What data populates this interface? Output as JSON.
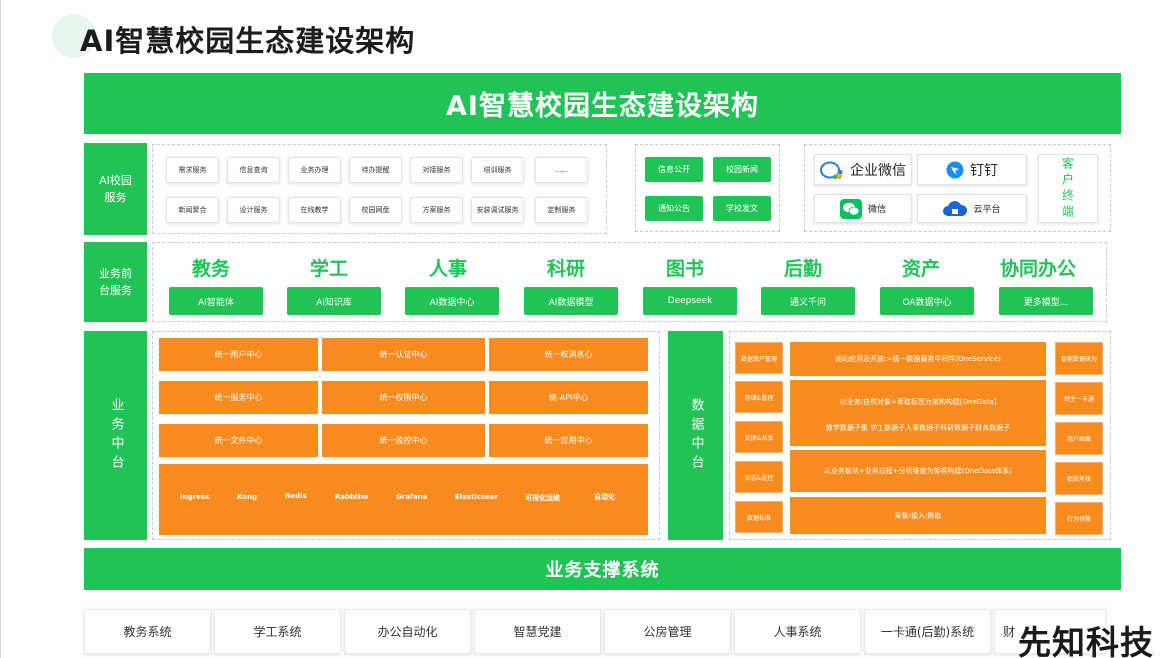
{
  "page_title": "AI智慧校园生态建设架构",
  "banner_title": "AI智慧校园生态建设架构",
  "row_labels": {
    "ai_services": "AI校园服务",
    "frontend": "业务前台服务",
    "business_center": "业务中台",
    "data_center": "数据中台"
  },
  "ai_services": {
    "grid": [
      "需求服务",
      "信息查询",
      "业务办理",
      "待办提醒",
      "对接服务",
      "培训服务",
      "......",
      "新闻聚合",
      "设计服务",
      "在线教学",
      "校园网盘",
      "方案服务",
      "安装调试服务",
      "定制服务"
    ],
    "green": [
      "信息公开",
      "校园新闻",
      "通知公告",
      "学校发文"
    ],
    "apps": [
      {
        "label": "企业微信",
        "icon": "wecom-icon",
        "color": "#2a7fe4"
      },
      {
        "label": "钉钉",
        "icon": "dingtalk-icon",
        "color": "#1a8cff"
      },
      {
        "label": "微信",
        "icon": "wechat-icon",
        "color": "#07c160"
      },
      {
        "label": "云平台",
        "icon": "cloud-icon",
        "color": "#1a66d6"
      }
    ],
    "client": "客户终端"
  },
  "modules": [
    {
      "title": "教务",
      "btn": "AI智能体"
    },
    {
      "title": "学工",
      "btn": "AI知识库"
    },
    {
      "title": "人事",
      "btn": "AI数据中心"
    },
    {
      "title": "科研",
      "btn": "AI数据模型"
    },
    {
      "title": "图书",
      "btn": "Deepseek"
    },
    {
      "title": "后勤",
      "btn": "通义千问"
    },
    {
      "title": "资产",
      "btn": "OA数据中心"
    },
    {
      "title": "协同办公",
      "btn": "更多模型..."
    }
  ],
  "business_grid": [
    "统一用户中心",
    "统一认证中心",
    "统一权消息心",
    "统一服务中心",
    "统一权限中心",
    "统-API中心",
    "统一文件中心",
    "统一监控中心",
    "统一应用中心"
  ],
  "tech_stack": [
    "Ingress",
    "Kong",
    "Redis",
    "Rabbitm",
    "Grafana",
    "Elasticsear",
    "可视化运维",
    "自动化"
  ],
  "data_left": [
    "数据资产管理",
    "存储&管理",
    "交换&共享",
    "日志&监控",
    "数据标准"
  ],
  "data_mid": [
    "面向应用及开放:>统一数据服务中间件(OneService)",
    "以业务/自然对象+萃取标签为架构构建[OneData]",
    "教学数据子集 学工数据子人事数据子科研数据子财务数据子",
    "以业务板块+业务过程+分析维度为架构构建(OneData体系)",
    "采集/接入/爬取"
  ],
  "data_right": [
    "智能数据研为",
    "师生一卡通",
    "用户画像",
    "绩效考核",
    "行为预警"
  ],
  "support_title": "业务支撑系统",
  "systems": [
    "教务系统",
    "学工系统",
    "办公自动化",
    "智慧党建",
    "公房管理",
    "人事系统",
    "一卡通(后勤)系统",
    "财"
  ],
  "watermark": "先知科技",
  "colors": {
    "green": "#21c356",
    "orange": "#f88b1e"
  }
}
